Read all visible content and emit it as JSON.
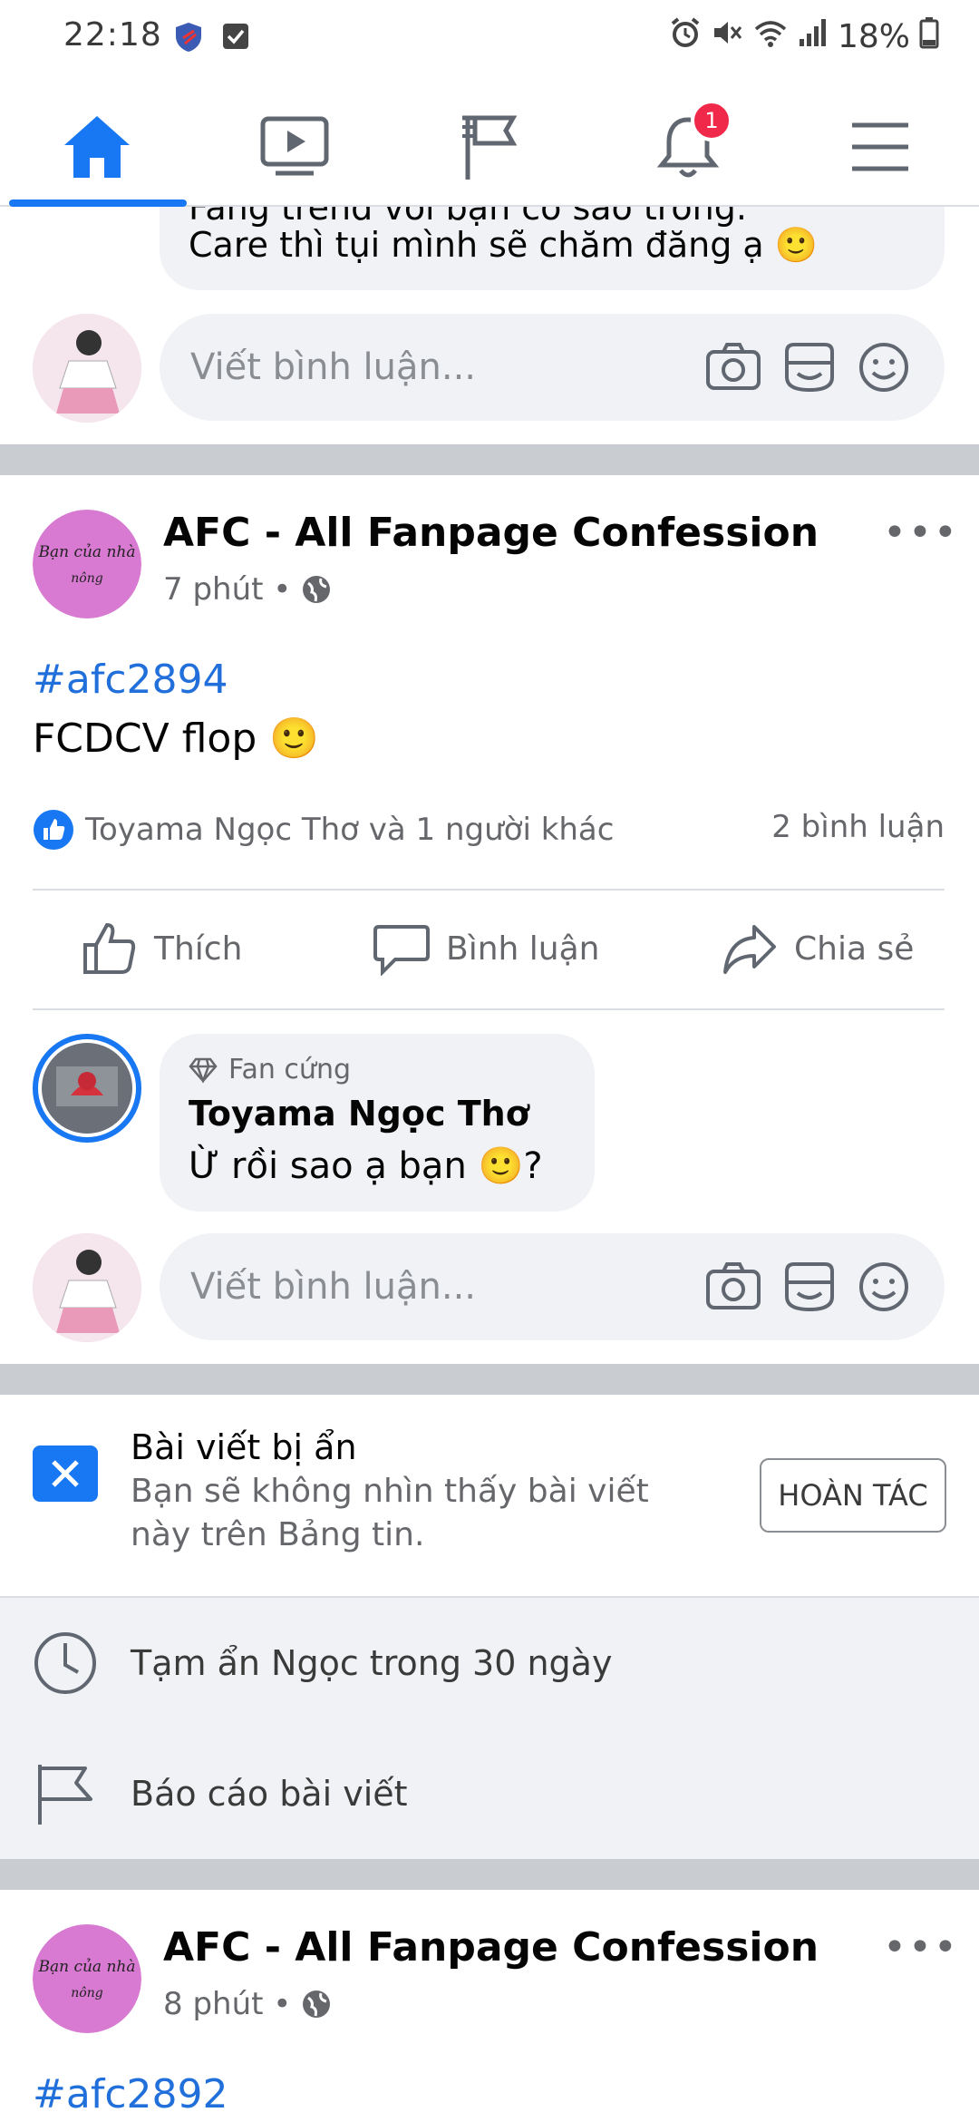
{
  "status_bar": {
    "time": "22:18",
    "battery": "18%"
  },
  "nav": {
    "tabs": [
      "home-icon",
      "video-icon",
      "pages-flag-icon",
      "notifications-bell-icon",
      "menu-icon"
    ],
    "notification_count": "1"
  },
  "top_comment": {
    "partial_line": "Fang trend với bạn có sáo trống.",
    "line": "Care thì tụi mình sẽ chăm đăng ạ 🙂"
  },
  "write_comment": {
    "placeholder": "Viết bình luận..."
  },
  "post1": {
    "page_name": "AFC - All Fanpage Confession",
    "time": "7 phút",
    "hashtag": "#afc2894",
    "text": "FCDCV flop 🙂",
    "reactions": "Toyama Ngọc Thơ và 1 người khác",
    "comments_count": "2 bình luận",
    "actions": {
      "like": "Thích",
      "comment": "Bình luận",
      "share": "Chia sẻ"
    },
    "comment": {
      "badge": "Fan cứng",
      "author": "Toyama Ngọc Thơ",
      "text": "Ừ rồi sao ạ bạn 🙂?"
    }
  },
  "hidden_post": {
    "title": "Bài viết bị ẩn",
    "desc_line1": "Bạn sẽ không nhìn thấy bài viết",
    "desc_line2": "này trên Bảng tin.",
    "undo": "HOÀN TÁC",
    "snooze": "Tạm ẩn Ngọc trong 30 ngày",
    "report": "Báo cáo bài viết"
  },
  "post2": {
    "page_name": "AFC - All Fanpage Confession",
    "time": "8 phút",
    "hashtag": "#afc2892"
  },
  "colors": {
    "accent": "#1877f2",
    "badge": "#f02849",
    "bubble": "#f0f2f5",
    "separator": "#c9ccd1"
  }
}
